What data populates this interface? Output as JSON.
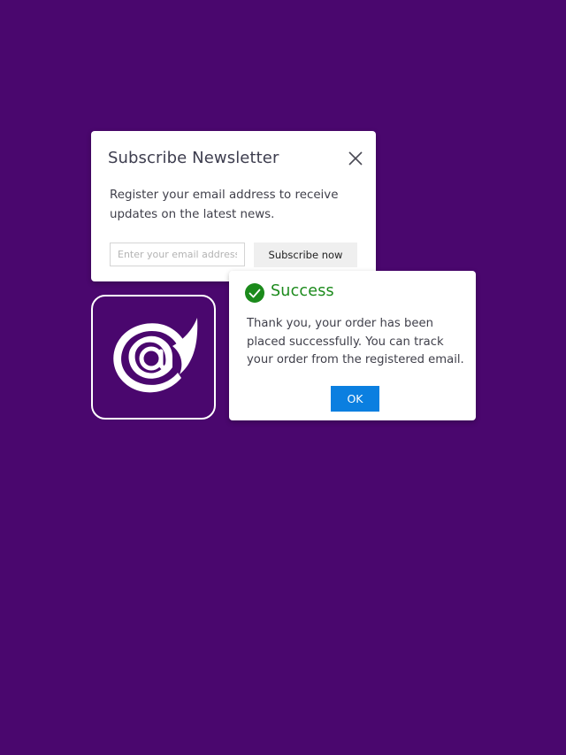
{
  "newsletter": {
    "title": "Subscribe Newsletter",
    "body": "Register your email address to receive updates on the latest news.",
    "email_placeholder": "Enter your email address",
    "email_value": "",
    "subscribe_label": "Subscribe now",
    "close_icon": "close-icon"
  },
  "logo": {
    "icon": "blazor-logo"
  },
  "success": {
    "title": "Success",
    "icon": "check-circle-icon",
    "body": "Thank you, your order has been placed successfully. You can track your order from the registered email.",
    "ok_label": "OK"
  },
  "colors": {
    "background": "#4a076e",
    "success_green": "#1b8a1b",
    "ok_blue": "#0b7fe0"
  }
}
